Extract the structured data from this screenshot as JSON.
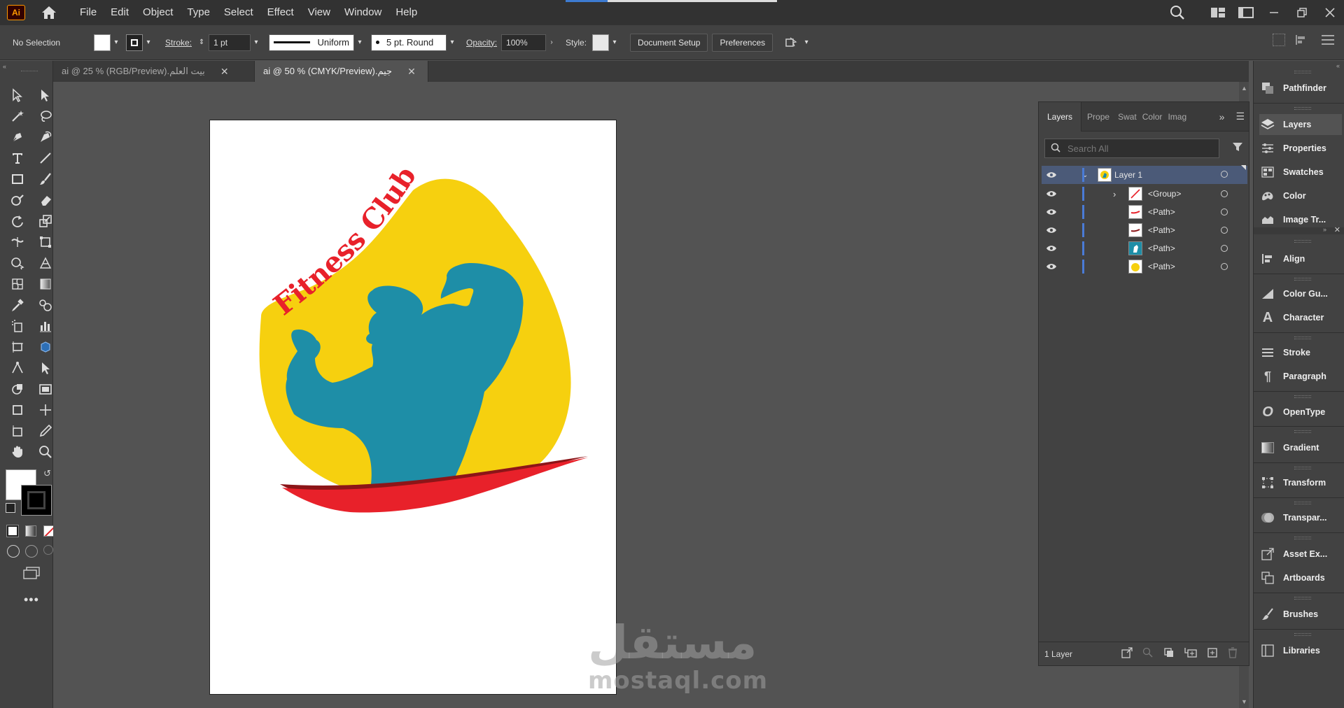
{
  "app": {
    "logo": "Ai"
  },
  "menu": [
    "File",
    "Edit",
    "Object",
    "Type",
    "Select",
    "Effect",
    "View",
    "Window",
    "Help"
  ],
  "control": {
    "selection": "No Selection",
    "stroke_label": "Stroke:",
    "stroke_weight": "1 pt",
    "stroke_profile": "Uniform",
    "brush": "5 pt. Round",
    "opacity_label": "Opacity:",
    "opacity": "100%",
    "style_label": "Style:",
    "document_setup": "Document Setup",
    "preferences": "Preferences"
  },
  "tabs": [
    {
      "label": "بيت العلم.ai @ 25 % (RGB/Preview)",
      "active": false
    },
    {
      "label": "جيم.ai @ 50 % (CMYK/Preview)",
      "active": true
    }
  ],
  "artwork": {
    "curved_text": "Fitness Club",
    "colors": {
      "yellow": "#f6d00f",
      "teal": "#1e8ea7",
      "red": "#e8212a",
      "dark_red": "#8c1518"
    }
  },
  "watermark": {
    "arabic": "مستقل",
    "latin": "mostaql.com"
  },
  "layers_panel": {
    "tabs": [
      "Layers",
      "Prope",
      "Swat",
      "Color",
      "Imag"
    ],
    "search_placeholder": "Search All",
    "rows": [
      {
        "name": "Layer 1",
        "level": 0,
        "expanded": true,
        "selected": true
      },
      {
        "name": "<Group>",
        "level": 1,
        "expanded": false
      },
      {
        "name": "<Path>",
        "level": 1
      },
      {
        "name": "<Path>",
        "level": 1
      },
      {
        "name": "<Path>",
        "level": 1
      },
      {
        "name": "<Path>",
        "level": 1
      }
    ],
    "footer": "1 Layer"
  },
  "dock": [
    {
      "label": "Pathfinder",
      "icon": "pathfinder-icon"
    },
    {
      "label": "Layers",
      "icon": "layers-icon",
      "active": true
    },
    {
      "label": "Properties",
      "icon": "properties-icon"
    },
    {
      "label": "Swatches",
      "icon": "swatches-icon"
    },
    {
      "label": "Color",
      "icon": "color-icon"
    },
    {
      "label": "Image Tr...",
      "icon": "image-trace-icon"
    },
    {
      "label": "Align",
      "icon": "align-icon"
    },
    {
      "label": "Color Gu...",
      "icon": "color-guide-icon"
    },
    {
      "label": "Character",
      "icon": "character-icon"
    },
    {
      "label": "Stroke",
      "icon": "stroke-icon"
    },
    {
      "label": "Paragraph",
      "icon": "paragraph-icon"
    },
    {
      "label": "OpenType",
      "icon": "opentype-icon"
    },
    {
      "label": "Gradient",
      "icon": "gradient-icon"
    },
    {
      "label": "Transform",
      "icon": "transform-icon"
    },
    {
      "label": "Transpar...",
      "icon": "transparency-icon"
    },
    {
      "label": "Asset Ex...",
      "icon": "asset-export-icon"
    },
    {
      "label": "Artboards",
      "icon": "artboards-icon"
    },
    {
      "label": "Brushes",
      "icon": "brushes-icon"
    },
    {
      "label": "Libraries",
      "icon": "libraries-icon"
    }
  ]
}
